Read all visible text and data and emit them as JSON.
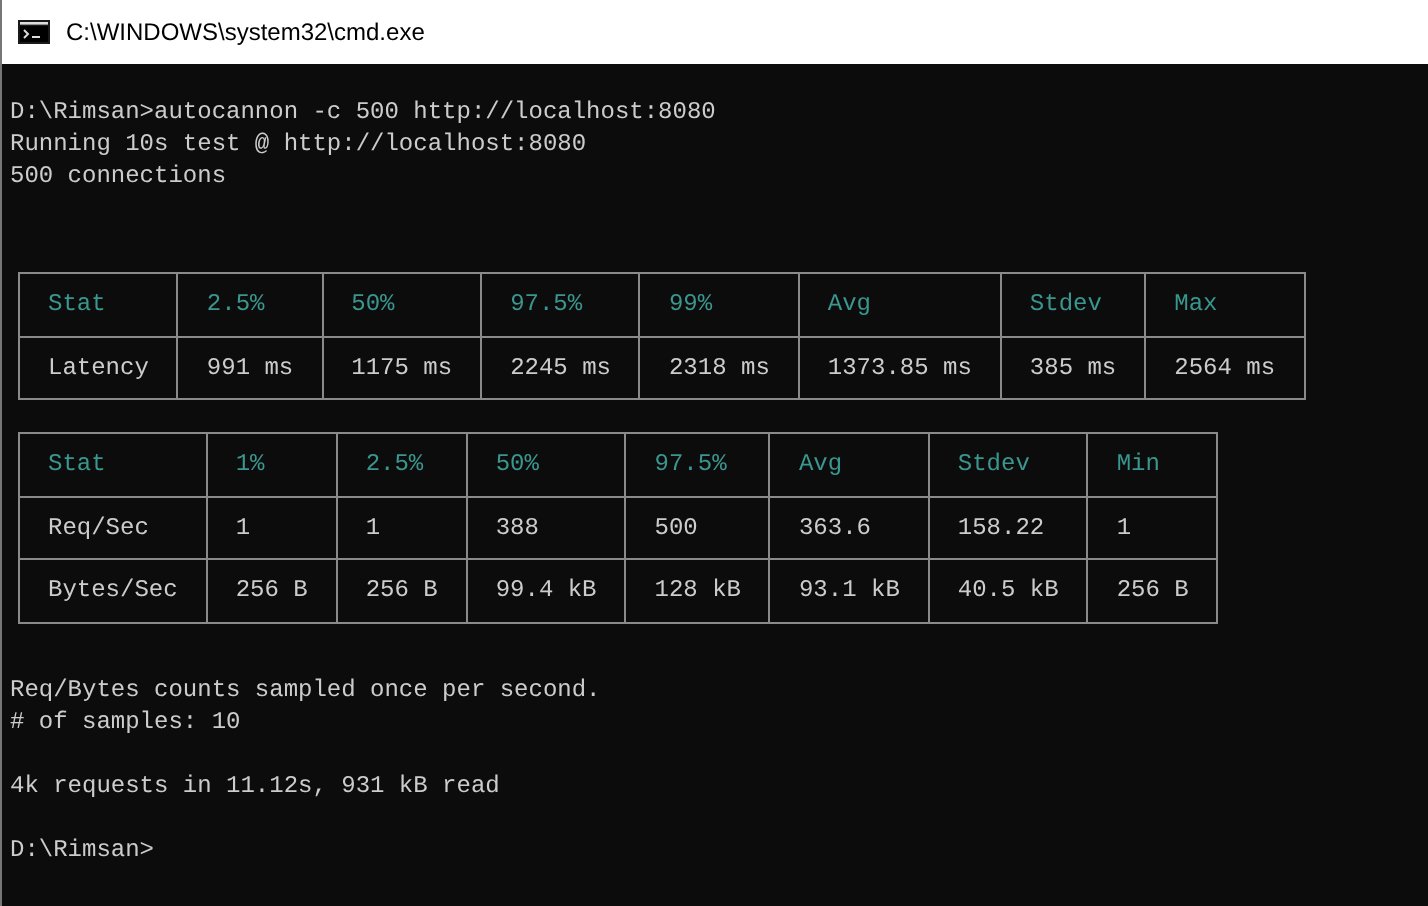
{
  "window": {
    "title": "C:\\WINDOWS\\system32\\cmd.exe"
  },
  "console": [
    {
      "kind": "line",
      "text": "D:\\Rimsan>autocannon -c 500 http://localhost:8080"
    },
    {
      "kind": "line",
      "text": "Running 10s test @ http://localhost:8080"
    },
    {
      "kind": "line",
      "text": "500 connections"
    },
    {
      "kind": "table",
      "columns": [
        "Stat",
        "2.5%",
        "50%",
        "97.5%",
        "99%",
        "Avg",
        "Stdev",
        "Max"
      ],
      "rows": [
        [
          "Latency",
          "991 ms",
          "1175 ms",
          "2245 ms",
          "2318 ms",
          "1373.85 ms",
          "385 ms",
          "2564 ms"
        ]
      ]
    },
    {
      "kind": "table",
      "columns": [
        "Stat",
        "1%",
        "2.5%",
        "50%",
        "97.5%",
        "Avg",
        "Stdev",
        "Min"
      ],
      "rows": [
        [
          "Req/Sec",
          "1",
          "1",
          "388",
          "500",
          "363.6",
          "158.22",
          "1"
        ],
        [
          "Bytes/Sec",
          "256 B",
          "256 B",
          "99.4 kB",
          "128 kB",
          "93.1 kB",
          "40.5 kB",
          "256 B"
        ]
      ]
    },
    {
      "kind": "line",
      "text": "Req/Bytes counts sampled once per second."
    },
    {
      "kind": "line",
      "text": "# of samples: 10"
    },
    {
      "kind": "blank"
    },
    {
      "kind": "line",
      "text": "4k requests in 11.12s, 931 kB read"
    },
    {
      "kind": "blank"
    },
    {
      "kind": "line",
      "text": "D:\\Rimsan>"
    }
  ]
}
